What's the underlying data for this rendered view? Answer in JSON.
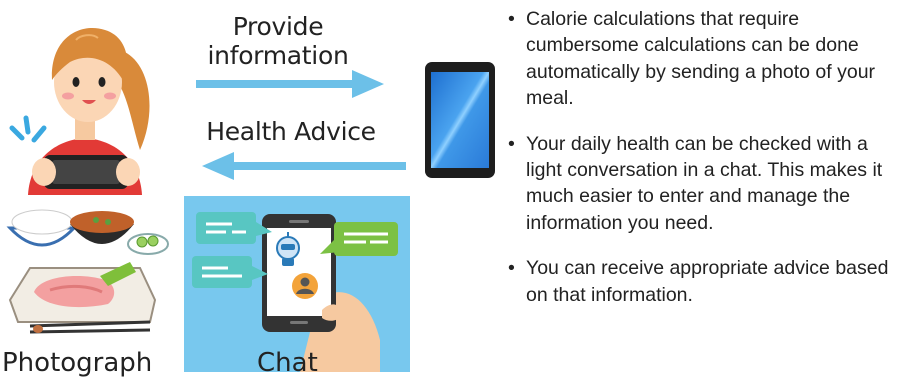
{
  "flow": {
    "provide_label": "Provide information",
    "advice_label": "Health Advice",
    "arrow_color": "#6cc0e8"
  },
  "captions": {
    "photograph": "Photograph",
    "chat": "Chat"
  },
  "bullets": [
    "Calorie calculations that require cumbersome calculations can be done automatically by sending a photo of your meal.",
    "Your daily health can be checked with a light conversation in a chat. This makes it much easier to enter and manage the information you need.",
    "You can receive appropriate advice based on that information."
  ],
  "colors": {
    "chat_panel": "#78c8ee",
    "bubble_teal": "#58c6c2",
    "bubble_green": "#7cc144",
    "phone_body": "#1e1e1e",
    "phone_screen": "#3a8ee0",
    "shirt": "#e23a36",
    "hair": "#d98a3a"
  },
  "icons": [
    "woman-photographing-icon",
    "meal-icon",
    "smartphone-icon",
    "chat-app-icon",
    "robot-avatar-icon",
    "user-avatar-icon"
  ]
}
